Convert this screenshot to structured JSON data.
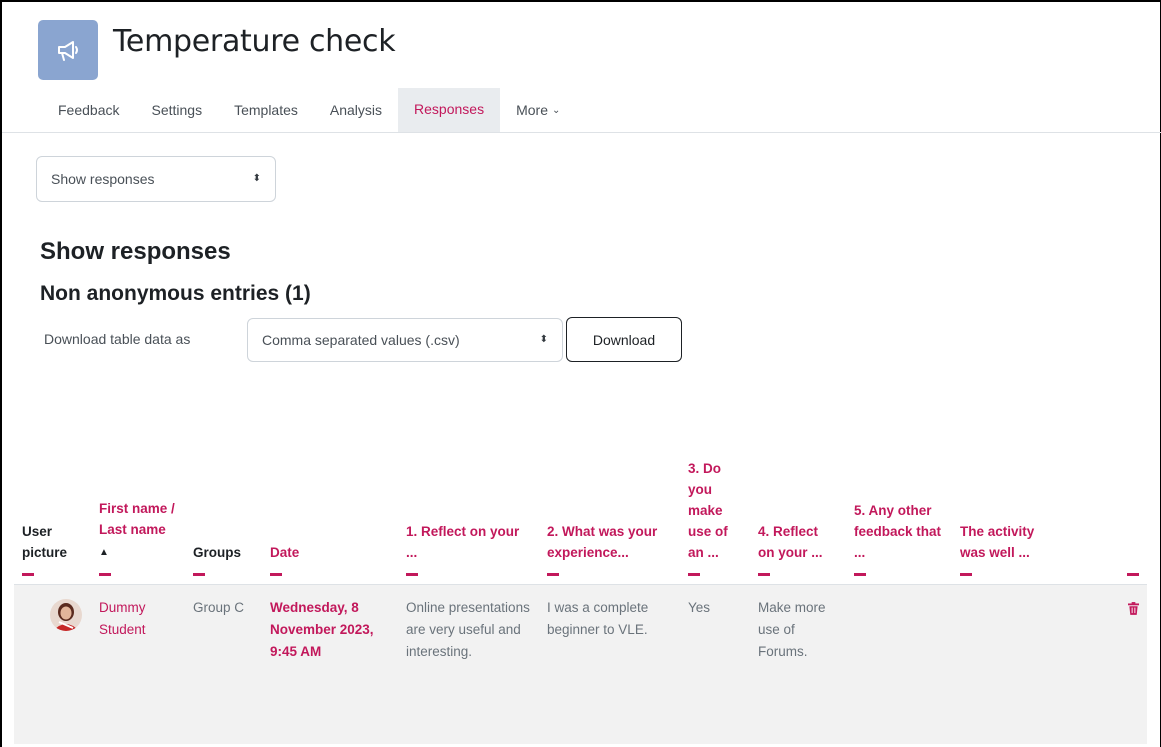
{
  "page": {
    "title": "Temperature check",
    "activity_icon": "megaphone-icon"
  },
  "tabs": [
    {
      "label": "Feedback"
    },
    {
      "label": "Settings"
    },
    {
      "label": "Templates"
    },
    {
      "label": "Analysis"
    },
    {
      "label": "Responses",
      "active": true
    },
    {
      "label": "More"
    }
  ],
  "view_select": {
    "value": "Show responses"
  },
  "headings": {
    "main": "Show responses",
    "sub": "Non anonymous entries (1)"
  },
  "download": {
    "label": "Download table data as",
    "format": "Comma separated values (.csv)",
    "button": "Download"
  },
  "table": {
    "columns": [
      {
        "label": "User picture"
      },
      {
        "label": "First name / Last name",
        "sort_indicator": "▲"
      },
      {
        "label": "Groups"
      },
      {
        "label": "Date"
      },
      {
        "label": "1. Reflect on your ..."
      },
      {
        "label": "2. What was your experience..."
      },
      {
        "label": "3. Do you make use of an ..."
      },
      {
        "label": "4. Reflect on your ..."
      },
      {
        "label": "5. Any other feedback that ..."
      },
      {
        "label": "The activity was well ..."
      },
      {
        "label": ""
      }
    ],
    "rows": [
      {
        "name": "Dummy Student",
        "group": "Group C",
        "date": "Wednesday, 8 November 2023, 9:45 AM",
        "q1": "Online presentations are very useful and interesting.",
        "q2": "I was a complete beginner to VLE.",
        "q3": "Yes",
        "q4": "Make more use of Forums.",
        "q5": "",
        "q6": "",
        "delete_icon": "trash-icon"
      }
    ]
  },
  "colors": {
    "accent": "#c2185b",
    "icon_bg": "#8aa5d0",
    "row_bg": "#f2f2f2"
  }
}
